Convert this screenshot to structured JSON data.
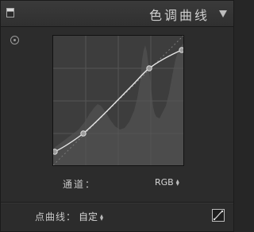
{
  "header": {
    "title": "色调曲线"
  },
  "curve": {
    "channel_label": "通道：",
    "channel_value": "RGB"
  },
  "footer": {
    "point_curve_label": "点曲线：",
    "point_curve_value": "自定"
  },
  "icons": {
    "panel_toggle": "panel-toggle-icon",
    "collapse": "triangle-down-icon",
    "target_adjust": "target-adjust-icon",
    "select_arrows": "up-down-arrows-icon",
    "edit_point_curve": "diagonal-curve-icon"
  },
  "colors": {
    "panel_bg": "#2c2c2c",
    "curve_area_bg": "#3d3d3d",
    "histogram": "#4c4c4c",
    "curve_line": "#e6e6e6"
  }
}
